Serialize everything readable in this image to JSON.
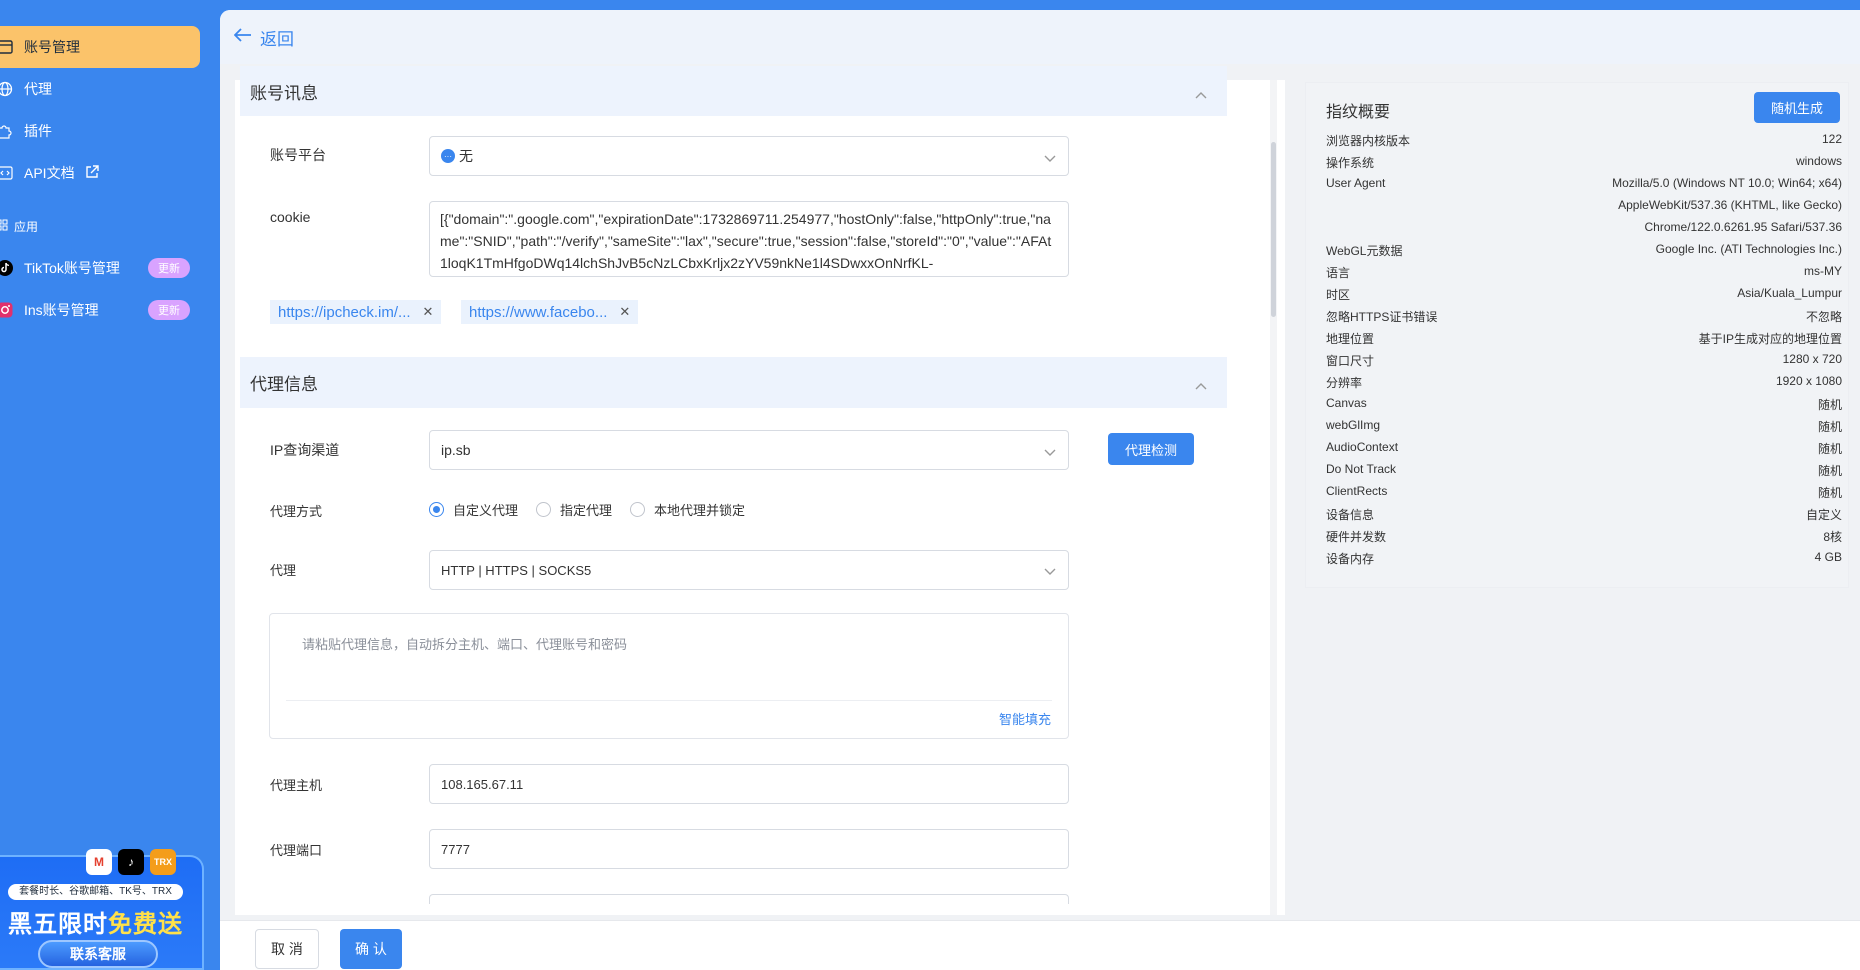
{
  "sidebar": {
    "items": [
      {
        "label": "账号管理",
        "icon": "account-card-icon"
      },
      {
        "label": "代理",
        "icon": "globe-icon"
      },
      {
        "label": "插件",
        "icon": "puzzle-icon"
      },
      {
        "label": "API文档",
        "icon": "code-icon"
      }
    ],
    "section_label": "应用",
    "apps": [
      {
        "label": "TikTok账号管理",
        "badge": "更新"
      },
      {
        "label": "Ins账号管理",
        "badge": "更新"
      }
    ],
    "promo": {
      "tags": "套餐时长、谷歌邮箱、TK号、TRX",
      "title_part1": "黑五限时",
      "title_highlight": "免费送",
      "button": "联系客服",
      "trx_label": "TRX",
      "mail_label": "M",
      "tiktok_label": "♪"
    }
  },
  "topbar": {
    "back_label": "返回"
  },
  "account_section": {
    "title": "账号讯息",
    "platform_label": "账号平台",
    "platform_value": "无",
    "cookie_label": "cookie",
    "cookie_value": "[{\"domain\":\".google.com\",\"expirationDate\":1732869711.254977,\"hostOnly\":false,\"httpOnly\":true,\"name\":\"SNID\",\"path\":\"/verify\",\"sameSite\":\"lax\",\"secure\":true,\"session\":false,\"storeId\":\"0\",\"value\":\"AFAt1loqK1TmHfgoDWq14lchShJvB5cNzLCbxKrljx2zYV59nkNe1l4SDwxxOnNrfKL-",
    "tags": [
      "https://ipcheck.im/...",
      "https://www.facebo..."
    ]
  },
  "proxy_section": {
    "title": "代理信息",
    "ip_channel_label": "IP查询渠道",
    "ip_channel_value": "ip.sb",
    "check_button": "代理检测",
    "mode_label": "代理方式",
    "modes": [
      "自定义代理",
      "指定代理",
      "本地代理并锁定"
    ],
    "selected_mode": "自定义代理",
    "proxy_label": "代理",
    "proxy_type_value": "HTTP | HTTPS | SOCKS5",
    "paste_placeholder": "请粘贴代理信息，自动拆分主机、端口、代理账号和密码",
    "smart_fill": "智能填充",
    "host_label": "代理主机",
    "host_value": "108.165.67.11",
    "port_label": "代理端口",
    "port_value": "7777"
  },
  "fingerprint": {
    "title": "指纹概要",
    "random_button": "随机生成",
    "rows": [
      {
        "k": "浏览器内核版本",
        "v": "122"
      },
      {
        "k": "操作系统",
        "v": "windows"
      },
      {
        "k": "User Agent",
        "v": "Mozilla/5.0 (Windows NT 10.0; Win64; x64)"
      },
      {
        "k": "",
        "v": "AppleWebKit/537.36 (KHTML, like Gecko)"
      },
      {
        "k": "",
        "v": "Chrome/122.0.6261.95 Safari/537.36"
      },
      {
        "k": "WebGL元数据",
        "v": "Google Inc. (ATI Technologies Inc.)"
      },
      {
        "k": "语言",
        "v": "ms-MY"
      },
      {
        "k": "时区",
        "v": "Asia/Kuala_Lumpur"
      },
      {
        "k": "忽略HTTPS证书错误",
        "v": "不忽略"
      },
      {
        "k": "地理位置",
        "v": "基于IP生成对应的地理位置"
      },
      {
        "k": "窗口尺寸",
        "v": "1280 x 720"
      },
      {
        "k": "分辨率",
        "v": "1920 x 1080"
      },
      {
        "k": "Canvas",
        "v": "随机"
      },
      {
        "k": "webGlImg",
        "v": "随机"
      },
      {
        "k": "AudioContext",
        "v": "随机"
      },
      {
        "k": "Do Not Track",
        "v": "随机"
      },
      {
        "k": "ClientRects",
        "v": "随机"
      },
      {
        "k": "设备信息",
        "v": "自定义"
      },
      {
        "k": "硬件并发数",
        "v": "8核"
      },
      {
        "k": "设备内存",
        "v": "4 GB"
      }
    ]
  },
  "footer": {
    "cancel": "取 消",
    "confirm": "确 认"
  },
  "colors": {
    "primary": "#3a86ee",
    "active_nav": "#fbc36a",
    "badge": "#d9a3ff"
  }
}
